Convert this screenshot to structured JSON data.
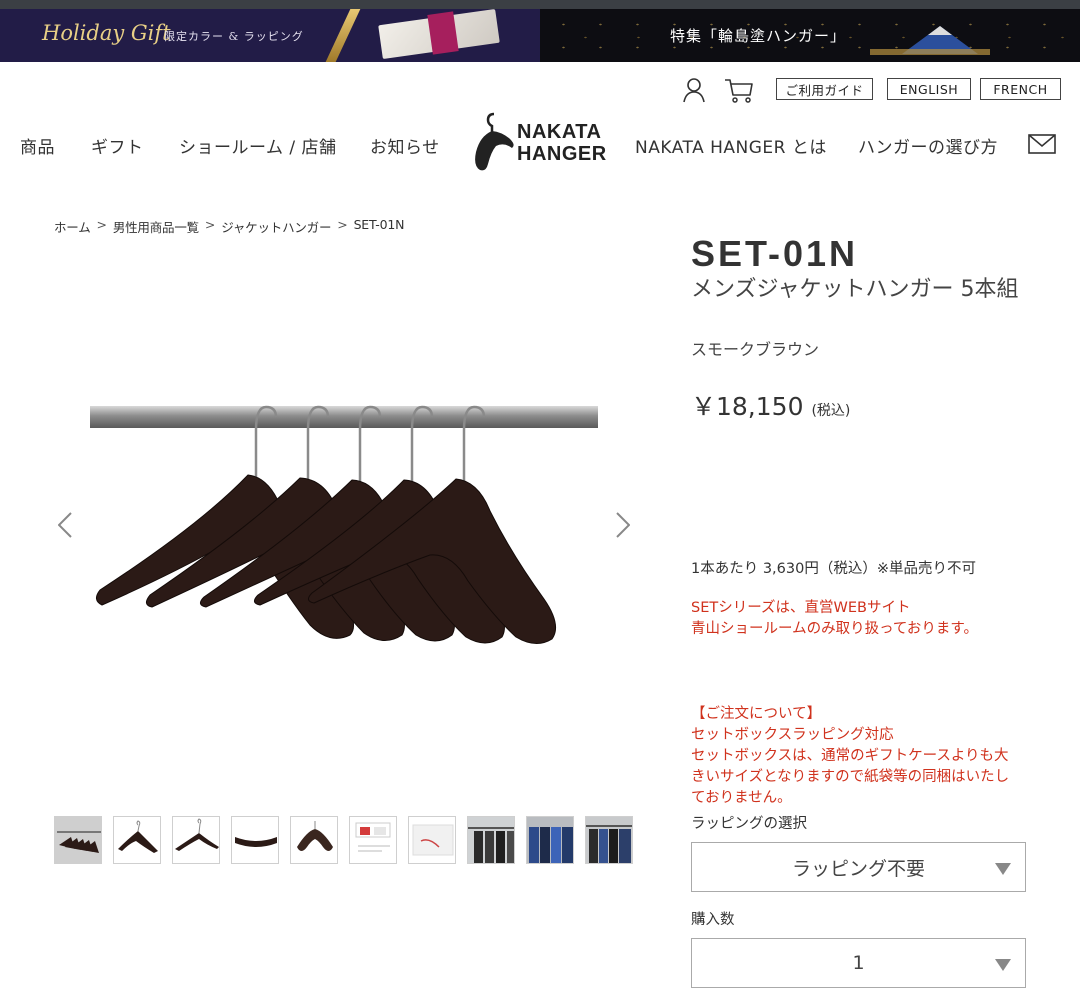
{
  "banner": {
    "left_title": "Holiday Gift",
    "left_subtitle": "限定カラー & ラッピング",
    "right_title": "特集「輪島塗ハンガー」"
  },
  "utility": {
    "guide_label": "ご利用ガイド",
    "english_label": "ENGLISH",
    "french_label": "FRENCH"
  },
  "nav": {
    "items": [
      "商品",
      "ギフト",
      "ショールーム / 店舗",
      "お知らせ",
      "NAKATA HANGER とは",
      "ハンガーの選び方"
    ],
    "logo_line1": "NAKATA",
    "logo_line2": "HANGER"
  },
  "breadcrumb": [
    "ホーム",
    "男性用商品一覧",
    "ジャケットハンガー",
    "SET-01N"
  ],
  "breadcrumb_sep": ">",
  "product": {
    "code": "SET-01N",
    "name": "メンズジャケットハンガー 5本組",
    "color": "スモークブラウン",
    "price": "￥18,150",
    "price_note": "(税込)",
    "unit_price": "1本あたり 3,630円（税込）※単品売り不可",
    "set_notice_line1": "SETシリーズは、直営WEBサイト",
    "set_notice_line2": "青山ショールームのみ取り扱っております。",
    "order_title": "【ご注文について】",
    "order_line1": "セットボックスラッピング対応",
    "order_line2": "セットボックスは、通常のギフトケースよりも大きいサイズとなりますので紙袋等の同梱はいたしておりません。",
    "wrapping_label": "ラッピングの選択",
    "wrapping_value": "ラッピング不要",
    "quantity_label": "購入数",
    "quantity_value": "1"
  },
  "colors": {
    "accent_red": "#d0321d",
    "banner_left_bg": "#221c47",
    "banner_right_bg": "#0d0d12",
    "hanger_wood": "#2b1a16"
  }
}
